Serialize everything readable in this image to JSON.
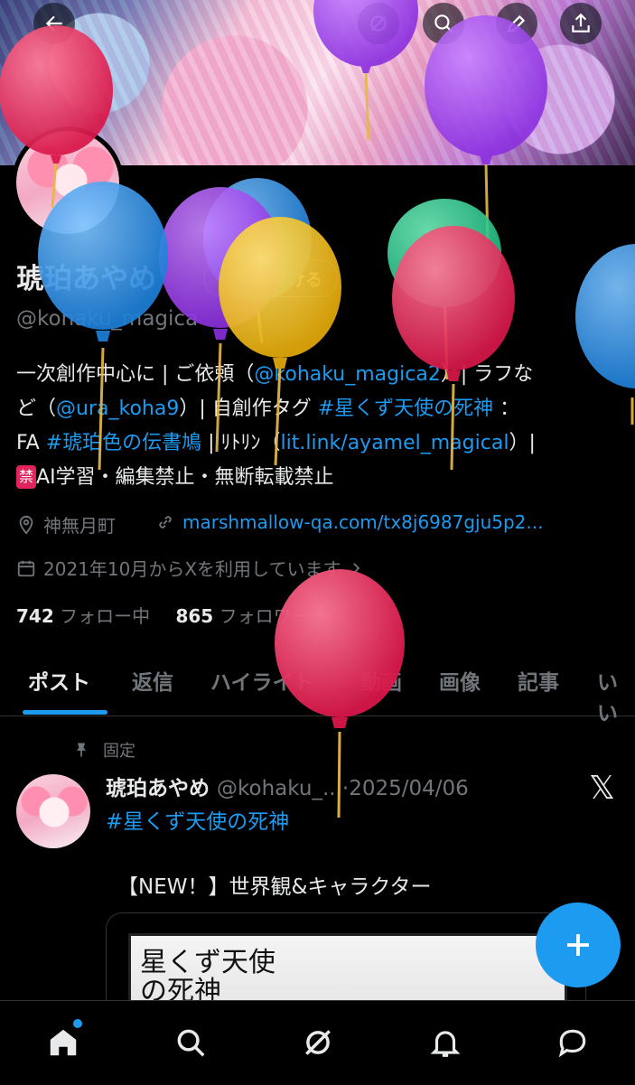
{
  "profile": {
    "name": "琥珀あやめ",
    "handle": "@kohaku_magica",
    "verify_button": "認証を受ける",
    "bio": {
      "line1_a": "一次創作中心に | ご依頼（",
      "mention1": "@kohaku_magica2",
      "line1_b": "）| ラフな",
      "line2_a": "ど（",
      "mention2": "@ura_koha9",
      "line2_b": "）| 自創作タグ ",
      "hashtag1": "#星くず天使の死神",
      "line2_c": " ：",
      "line3_a": "FA ",
      "hashtag2": "#琥珀色の伝書鳩",
      "line3_b": " | ﾘﾄﾘﾝ（",
      "link": "lit.link/ayamel_magical",
      "line3_c": "）|",
      "prohibit_badge": "禁",
      "line4": "AI学習・編集禁止・無断転載禁止"
    },
    "location": "神無月町",
    "website": "marshmallow-qa.com/tx8j6987gju5p2...",
    "joined": "2021年10月からXを利用しています",
    "following_count": "742",
    "following_label": "フォロー中",
    "followers_count": "865",
    "followers_label": "フォロワー"
  },
  "tabs": [
    {
      "label": "ポスト",
      "active": true
    },
    {
      "label": "返信"
    },
    {
      "label": "ハイライト"
    },
    {
      "label": "動画"
    },
    {
      "label": "画像"
    },
    {
      "label": "記事"
    },
    {
      "label": "いい"
    }
  ],
  "pinned_post": {
    "pinned_label": "固定",
    "author": "琥珀あやめ",
    "handle": "@kohaku_...",
    "separator": "·",
    "date": "2025/04/06",
    "hashtag": "#星くず天使の死神",
    "text": "【NEW！】世界観&キャラクター",
    "media_title_1": "星くず天使",
    "media_title_2": "の死神",
    "platform_mark": "𝕏"
  },
  "icons": {
    "header": [
      "back-arrow-icon",
      "grok-icon",
      "search-icon",
      "edit-icon",
      "share-icon"
    ],
    "bottom_nav": [
      "home-icon",
      "search-icon",
      "grok-icon",
      "notifications-icon",
      "messages-icon"
    ],
    "fab": "plus-icon"
  },
  "colors": {
    "accent": "#1d9bf0",
    "background": "#000000",
    "text": "#e7e9ea",
    "muted": "#71767b"
  }
}
